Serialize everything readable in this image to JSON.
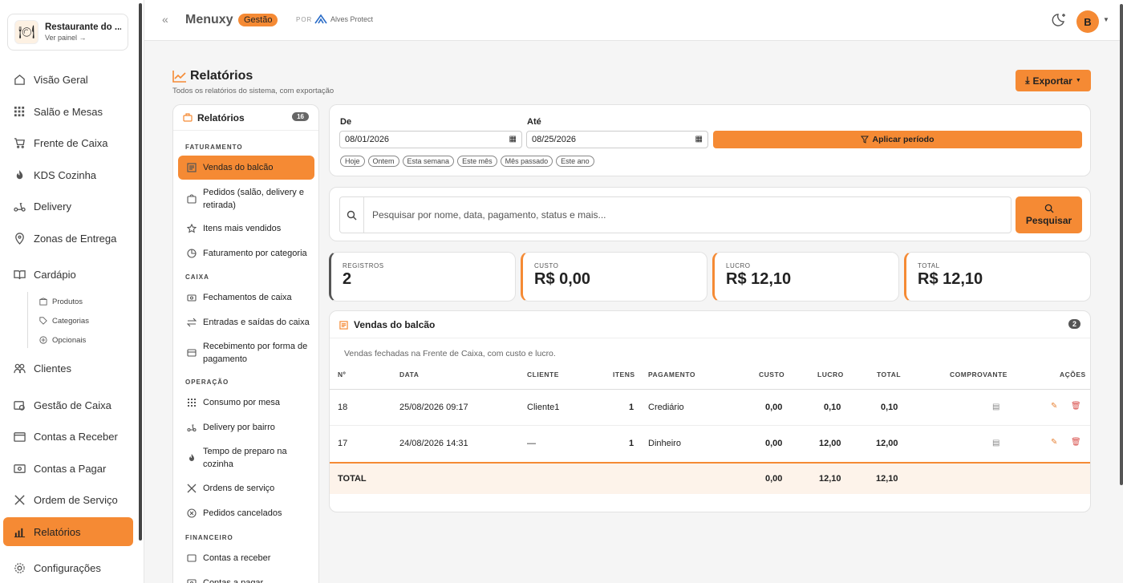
{
  "brand": {
    "name": "Restaurante do ...",
    "link": "Ver painel →"
  },
  "nav": [
    {
      "label": "Visão Geral",
      "icon": "home-icon"
    },
    {
      "label": "Salão e Mesas",
      "icon": "grid-icon"
    },
    {
      "label": "Frente de Caixa",
      "icon": "cart-icon"
    },
    {
      "label": "KDS Cozinha",
      "icon": "flame-icon"
    },
    {
      "label": "Delivery",
      "icon": "scooter-icon"
    },
    {
      "label": "Zonas de Entrega",
      "icon": "map-pin-icon"
    },
    {
      "label": "Cardápio",
      "icon": "book-icon"
    },
    {
      "label": "Clientes",
      "icon": "users-icon"
    },
    {
      "label": "Gestão de Caixa",
      "icon": "cashbox-icon"
    },
    {
      "label": "Contas a Receber",
      "icon": "wallet-icon"
    },
    {
      "label": "Contas a Pagar",
      "icon": "banknote-icon"
    },
    {
      "label": "Ordem de Serviço",
      "icon": "tools-icon"
    },
    {
      "label": "Relatórios",
      "icon": "bar-chart-icon"
    },
    {
      "label": "Configurações",
      "icon": "gear-icon"
    }
  ],
  "subnav": [
    {
      "label": "Produtos",
      "icon": "box-icon"
    },
    {
      "label": "Categorias",
      "icon": "tag-icon"
    },
    {
      "label": "Opcionais",
      "icon": "plus-circle-icon"
    }
  ],
  "topbar": {
    "app": "Menuxy",
    "badge": "Gestão",
    "por": "POR",
    "partner": "Alves Protect",
    "avatar": "B"
  },
  "page": {
    "title": "Relatórios",
    "subtitle": "Todos os relatórios do sistema, com exportação",
    "export": "Exportar"
  },
  "reports": {
    "title": "Relatórios",
    "count": "16",
    "sections": [
      "FATURAMENTO",
      "CAIXA",
      "OPERAÇÃO",
      "FINANCEIRO"
    ],
    "items": [
      "Vendas do balcão",
      "Pedidos (salão, delivery e retirada)",
      "Itens mais vendidos",
      "Faturamento por categoria",
      "Fechamentos de caixa",
      "Entradas e saídas do caixa",
      "Recebimento por forma de pagamento",
      "Consumo por mesa",
      "Delivery por bairro",
      "Tempo de preparo na cozinha",
      "Ordens de serviço",
      "Pedidos cancelados",
      "Contas a receber",
      "Contas a pagar"
    ]
  },
  "period": {
    "from_label": "De",
    "from_value": "08/01/2026",
    "to_label": "Até",
    "to_value": "08/25/2026",
    "apply": "Aplicar período",
    "chips": [
      "Hoje",
      "Ontem",
      "Esta semana",
      "Este mês",
      "Mês passado",
      "Este ano"
    ]
  },
  "search": {
    "placeholder": "Pesquisar por nome, data, pagamento, status e mais...",
    "button": "Pesquisar"
  },
  "stats": [
    {
      "label": "REGISTROS",
      "value": "2"
    },
    {
      "label": "CUSTO",
      "value": "R$ 0,00"
    },
    {
      "label": "LUCRO",
      "value": "R$ 12,10"
    },
    {
      "label": "TOTAL",
      "value": "R$ 12,10"
    }
  ],
  "table": {
    "title": "Vendas do balcão",
    "count": "2",
    "description": "Vendas fechadas na Frente de Caixa, com custo e lucro.",
    "headers": [
      "Nº",
      "DATA",
      "CLIENTE",
      "ITENS",
      "PAGAMENTO",
      "CUSTO",
      "LUCRO",
      "TOTAL",
      "COMPROVANTE",
      "AÇÕES"
    ],
    "rows": [
      {
        "num": "18",
        "date": "25/08/2026 09:17",
        "client": "Cliente1",
        "items": "1",
        "payment": "Crediário",
        "cost": "0,00",
        "profit": "0,10",
        "total": "0,10"
      },
      {
        "num": "17",
        "date": "24/08/2026 14:31",
        "client": "—",
        "items": "1",
        "payment": "Dinheiro",
        "cost": "0,00",
        "profit": "12,00",
        "total": "12,00"
      }
    ],
    "totals": {
      "label": "TOTAL",
      "cost": "0,00",
      "profit": "12,10",
      "total": "12,10"
    }
  }
}
